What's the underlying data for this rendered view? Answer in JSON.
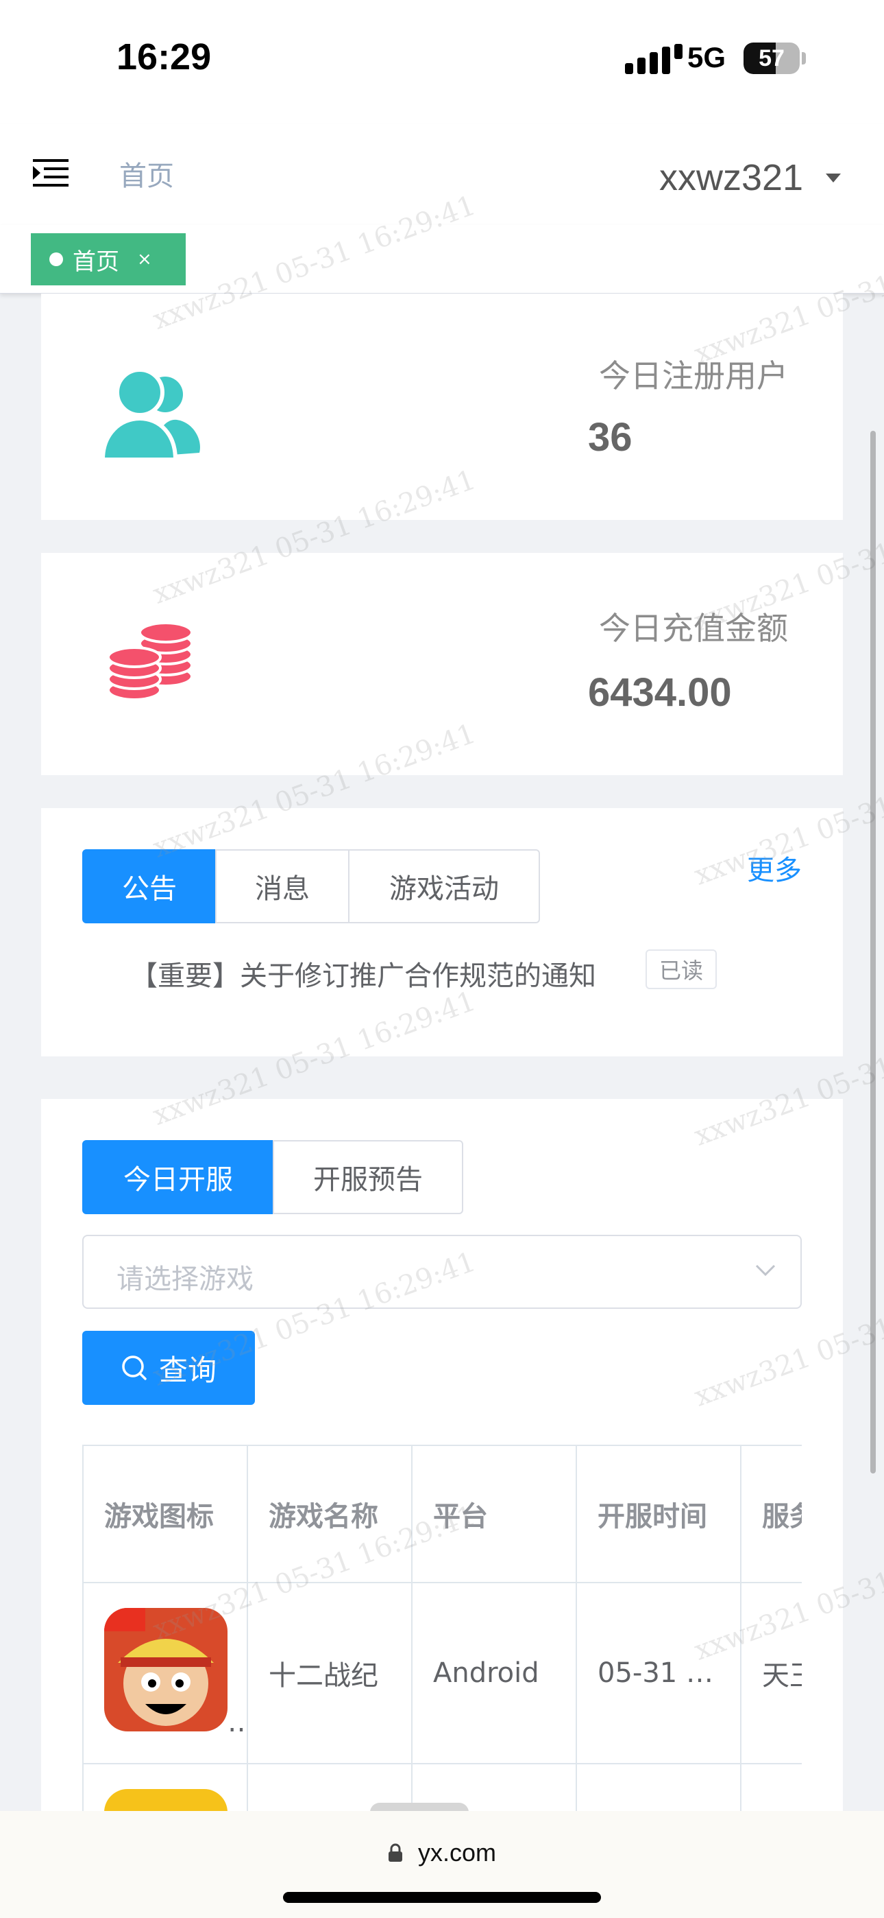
{
  "status_bar": {
    "time": "16:29",
    "network": "5G",
    "battery": "57"
  },
  "header": {
    "breadcrumb": "首页",
    "username": "xxwz321"
  },
  "tags": [
    {
      "label": "首页",
      "close": "×"
    }
  ],
  "stats": {
    "register": {
      "label": "今日注册用户",
      "value": "36",
      "icon": "people-icon",
      "color": "#40c9c6"
    },
    "recharge": {
      "label": "今日充值金额",
      "value": "6434.00",
      "icon": "coins-icon",
      "color": "#f4516c"
    }
  },
  "notice_panel": {
    "tabs": [
      "公告",
      "消息",
      "游戏活动"
    ],
    "active_tab": "公告",
    "more": "更多",
    "items": [
      {
        "title": "【重要】关于修订推广合作规范的通知",
        "status": "已读"
      }
    ]
  },
  "server_panel": {
    "tabs": [
      "今日开服",
      "开服预告"
    ],
    "active_tab": "今日开服",
    "select_placeholder": "请选择游戏",
    "query_button": "查询",
    "table": {
      "headers": [
        "游戏图标",
        "游戏名称",
        "平台",
        "开服时间",
        "服务信息"
      ],
      "rows": [
        {
          "name": "十二战纪",
          "platform": "Android",
          "time": "05-31 …",
          "info": "天王"
        }
      ]
    }
  },
  "watermark": "xxwz321 05-31 16:29:41",
  "browser": {
    "url": "yx.com"
  },
  "colors": {
    "primary": "#1890ff",
    "tag": "#42b983"
  }
}
